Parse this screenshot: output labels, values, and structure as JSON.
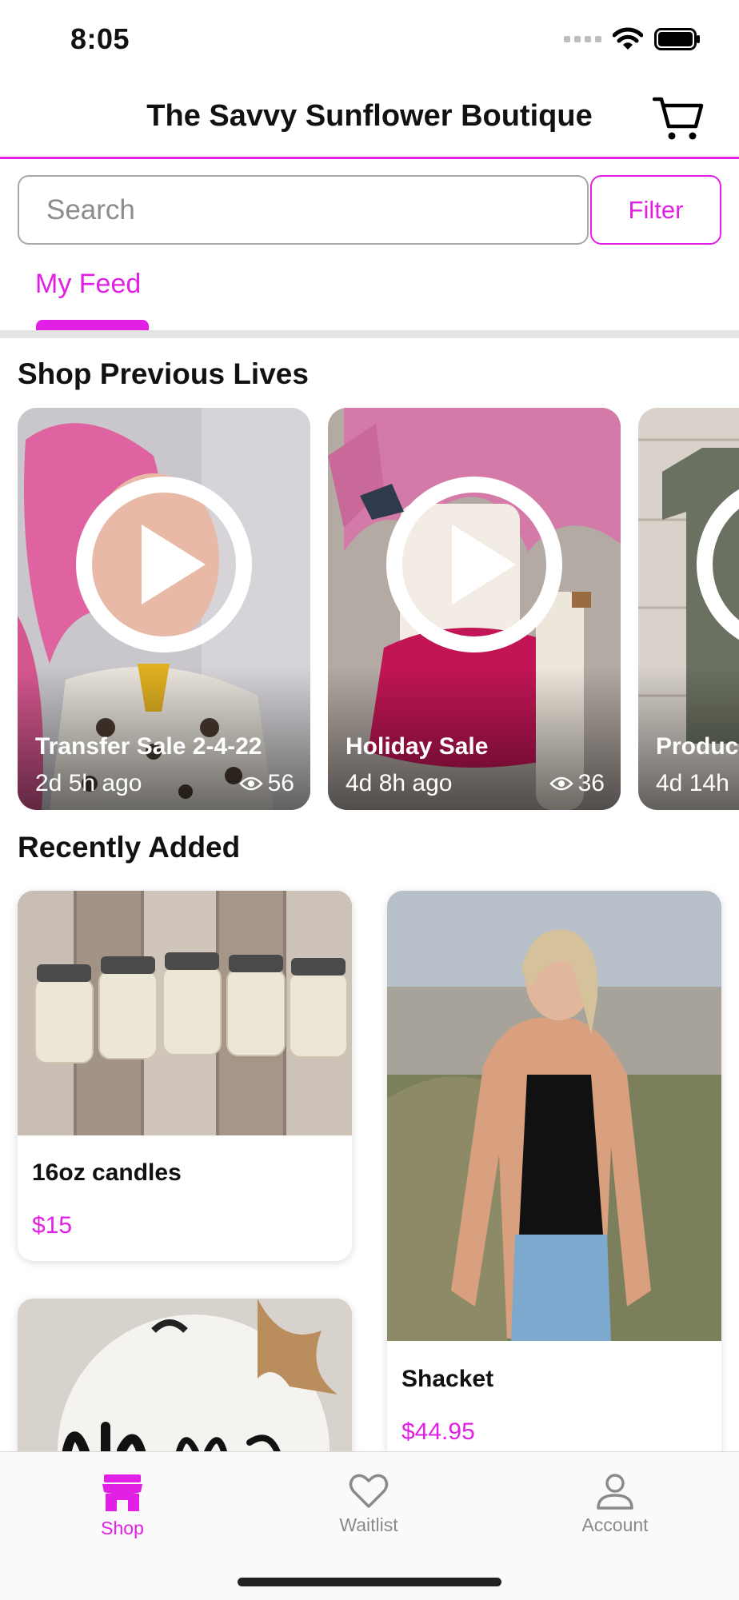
{
  "status_bar": {
    "time": "8:05"
  },
  "header": {
    "title": "The Savvy Sunflower Boutique"
  },
  "search": {
    "placeholder": "Search",
    "filter_label": "Filter"
  },
  "tabs": [
    {
      "label": "My Feed",
      "active": true
    }
  ],
  "previous_lives": {
    "title": "Shop Previous Lives",
    "items": [
      {
        "name": "Transfer Sale 2-4-22",
        "ago": "2d 5h ago",
        "views": "56"
      },
      {
        "name": "Holiday Sale",
        "ago": "4d 8h ago",
        "views": "36"
      },
      {
        "name": "Produc",
        "ago": "4d 14h",
        "views": ""
      }
    ]
  },
  "recently_added": {
    "title": "Recently Added",
    "items": [
      {
        "name": "16oz candles",
        "price": "$15"
      },
      {
        "name": "Shacket",
        "price": "$44.95"
      },
      {
        "name": "",
        "price": ""
      }
    ]
  },
  "bottom_nav": {
    "items": [
      {
        "label": "Shop",
        "icon": "store-icon",
        "active": true
      },
      {
        "label": "Waitlist",
        "icon": "heart-icon",
        "active": false
      },
      {
        "label": "Account",
        "icon": "person-icon",
        "active": false
      }
    ]
  },
  "colors": {
    "accent": "#e21fe4",
    "text": "#111111",
    "muted": "#8c8c8c"
  }
}
